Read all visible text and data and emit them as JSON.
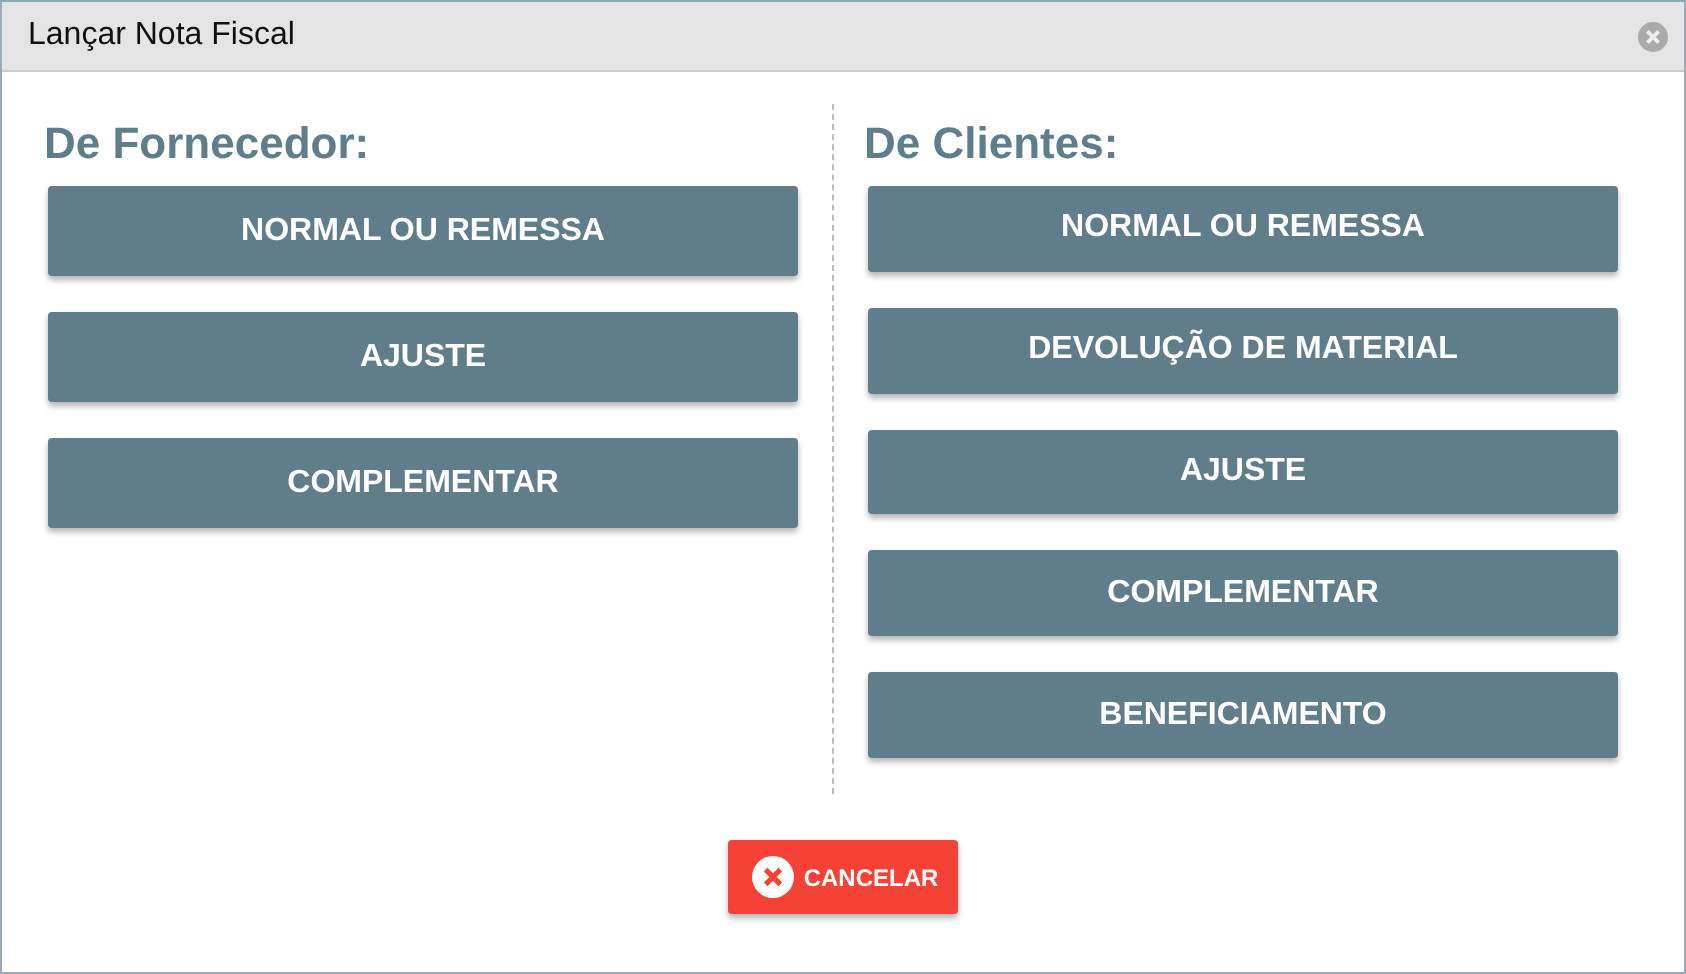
{
  "window": {
    "title": "Lançar Nota Fiscal"
  },
  "columns": [
    {
      "heading": "De Fornecedor:",
      "buttons": [
        "NORMAL OU REMESSA",
        "AJUSTE",
        "COMPLEMENTAR"
      ]
    },
    {
      "heading": "De Clientes:",
      "buttons": [
        "NORMAL OU REMESSA",
        "DEVOLUÇÃO DE MATERIAL",
        "AJUSTE",
        "COMPLEMENTAR",
        "BENEFICIAMENTO"
      ]
    }
  ],
  "cancel_button": {
    "label": "CANCELAR"
  }
}
